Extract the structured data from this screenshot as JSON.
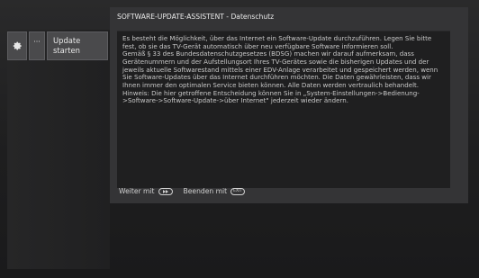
{
  "dialog": {
    "title": "SOFTWARE-UPDATE-ASSISTENT - Datenschutz",
    "paragraphs": [
      "Es besteht die Möglichkeit, über das Internet ein Software-Update durchzuführen. Legen Sie bitte fest, ob sie das TV-Gerät automatisch über neu verfügbare Software informieren soll.",
      "Gemäß § 33 des Bundesdatenschutzgesetzes (BDSG) machen wir darauf aufmerksam, dass Gerätenummern und der Aufstellungsort Ihres TV-Gerätes sowie die bisherigen Updates und der jeweils aktuelle Softwarestand mittels einer EDV-Anlage verarbeitet und gespeichert werden, wenn Sie Software-Updates über das Internet durchführen möchten. Die Daten gewährleisten, dass wir Ihnen immer den optimalen Service bieten können. Alle Daten werden vertraulich behandelt.",
      "Hinweis: Die hier getroffene Entscheidung können Sie in „System-Einstellungen->Bedienung->Software->Software-Update->über Internet\" jederzeit wieder ändern."
    ]
  },
  "footer": {
    "continue_label": "Weiter mit",
    "continue_key_icon": "forward-key-icon",
    "exit_label": "Beenden mit",
    "exit_key_text": "EXIT"
  },
  "sidebar": {
    "gear_icon": "gear-icon",
    "more_label": "···",
    "update_label": "Update starten"
  },
  "colors": {
    "background": "#1c1c1d",
    "dialog": "#343436",
    "body_panel": "#1f1f20",
    "button": "#4a4a4c"
  }
}
